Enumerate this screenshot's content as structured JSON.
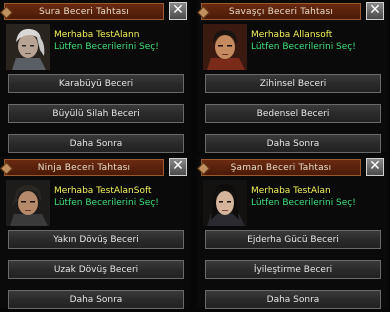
{
  "panels": [
    {
      "title": "Sura Beceri Tahtası",
      "greeting": "Merhaba TestAlann",
      "instruction": "Lütfen Becerilerini Seç!",
      "close_label": "✕",
      "buttons": [
        "Karabüyü Beceri",
        "Büyülü Silah Beceri",
        "Daha Sonra"
      ],
      "portrait": "sura-character-portrait"
    },
    {
      "title": "Savaşçı Beceri Tahtası",
      "greeting": "Merhaba Allansoft",
      "instruction": "Lütfen Becerilerini Seç!",
      "close_label": "✕",
      "buttons": [
        "Zihinsel Beceri",
        "Bedensel Beceri",
        "Daha Sonra"
      ],
      "portrait": "warrior-character-portrait"
    },
    {
      "title": "Ninja Beceri Tahtası",
      "greeting": "Merhaba TestAlanSoft",
      "instruction": "Lütfen Becerilerini Seç!",
      "close_label": "✕",
      "buttons": [
        "Yakın Dövüş Beceri",
        "Uzak Dövüş Beceri",
        "Daha Sonra"
      ],
      "portrait": "ninja-character-portrait"
    },
    {
      "title": "Şaman Beceri Tahtası",
      "greeting": "Merhaba TestAlan",
      "instruction": "Lütfen Becerilerini Seç!",
      "close_label": "✕",
      "buttons": [
        "Ejderha Gücü Beceri",
        "İyileştirme Beceri",
        "Daha Sonra"
      ],
      "portrait": "shaman-character-portrait"
    }
  ],
  "colors": {
    "greeting": "#f2f25a",
    "instruction": "#3ee07a",
    "titlebar": "#5a2210"
  }
}
